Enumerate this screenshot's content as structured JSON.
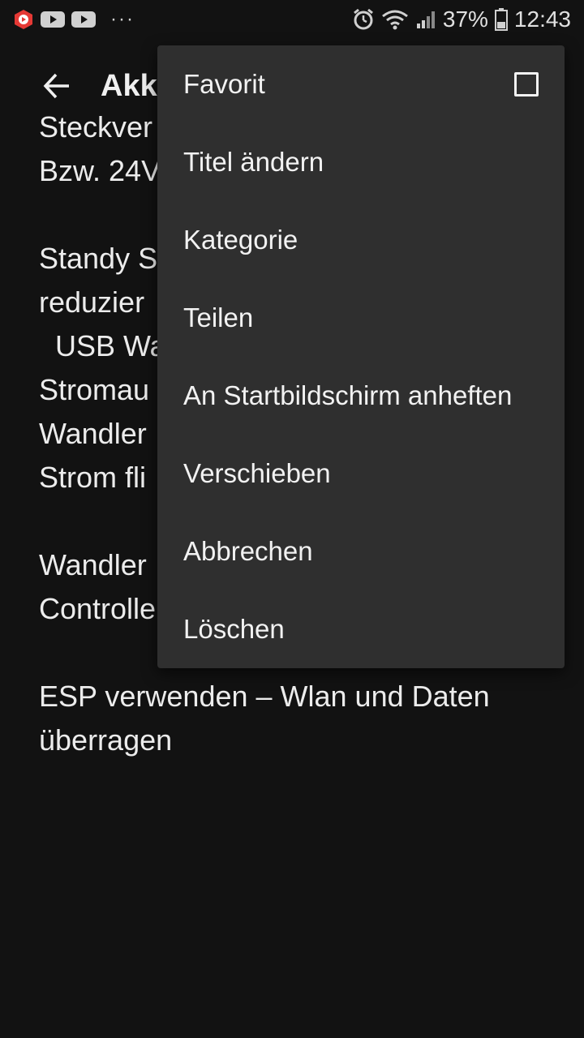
{
  "status_bar": {
    "battery": "37%",
    "time": "12:43",
    "overflow": "···"
  },
  "app_bar": {
    "title": "Akku"
  },
  "note_lines": [
    "Steckver",
    "Bzw. 24V",
    "",
    "Standy S",
    "reduzier",
    "  USB Wa",
    "Stromau",
    "Wandler",
    "Strom fli",
    "",
    "Wandler",
    "Controlle",
    "",
    "ESP verwenden – Wlan und Daten",
    "überragen"
  ],
  "menu": {
    "favorite_label": "Favorit",
    "favorite_checked": false,
    "items": [
      "Titel ändern",
      "Kategorie",
      "Teilen",
      "An Startbildschirm anheften",
      "Verschieben",
      "Abbrechen",
      "Löschen"
    ]
  }
}
